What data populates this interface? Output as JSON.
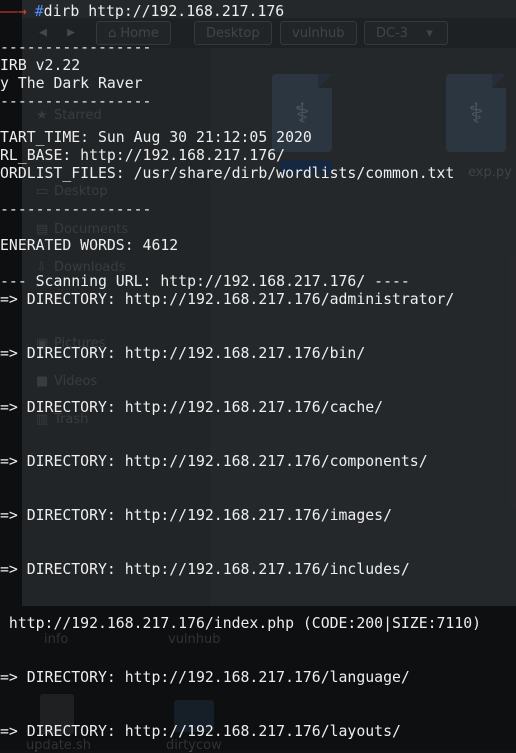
{
  "file_manager": {
    "toolbar": {
      "back_icon": "arrow-left-icon",
      "forward_icon": "arrow-right-icon",
      "home_icon": "home-icon",
      "crumbs": [
        "Home",
        "Desktop",
        "vulnhub",
        "DC-3"
      ],
      "dropdown_icon": "caret-down-icon"
    },
    "sidebar": [
      {
        "label": "Starred",
        "icon": "star-icon"
      },
      {
        "label": "Desktop",
        "icon": "desktop-icon"
      },
      {
        "label": "Documents",
        "icon": "document-icon"
      },
      {
        "label": "Downloads",
        "icon": "download-icon"
      },
      {
        "label": "Pictures",
        "icon": "picture-icon"
      },
      {
        "label": "Videos",
        "icon": "video-icon"
      },
      {
        "label": "Trash",
        "icon": "trash-icon"
      }
    ],
    "files": [
      {
        "label": "",
        "icon": "python-file-icon"
      },
      {
        "label": "exp.py",
        "icon": "python-file-icon"
      }
    ]
  },
  "desktop": {
    "items": [
      {
        "label": "info",
        "icon": "file-icon"
      },
      {
        "label": "vulnhub",
        "icon": "folder-icon"
      },
      {
        "label": "update.sh",
        "icon": "script-file-icon"
      },
      {
        "label": "dirtycow",
        "icon": "folder-icon"
      }
    ]
  },
  "terminal": {
    "prompt_arrow": "——→",
    "prompt_hash": "#",
    "command": "dirb http://192.168.217.176",
    "lines": [
      "-----------------",
      "IRB v2.22",
      "y The Dark Raver",
      "-----------------",
      "",
      "TART_TIME: Sun Aug 30 21:12:05 2020",
      "RL_BASE: http://192.168.217.176/",
      "ORDLIST_FILES: /usr/share/dirb/wordlists/common.txt",
      "",
      "-----------------",
      "",
      "ENERATED WORDS: 4612",
      "",
      "--- Scanning URL: http://192.168.217.176/ ----",
      "=> DIRECTORY: http://192.168.217.176/administrator/",
      "",
      "",
      "=> DIRECTORY: http://192.168.217.176/bin/",
      "",
      "",
      "=> DIRECTORY: http://192.168.217.176/cache/",
      "",
      "",
      "=> DIRECTORY: http://192.168.217.176/components/",
      "",
      "",
      "=> DIRECTORY: http://192.168.217.176/images/",
      "",
      "",
      "=> DIRECTORY: http://192.168.217.176/includes/",
      "",
      "",
      " http://192.168.217.176/index.php (CODE:200|SIZE:7110)",
      "",
      "",
      "=> DIRECTORY: http://192.168.217.176/language/",
      "",
      "",
      "=> DIRECTORY: http://192.168.217.176/layouts/"
    ]
  },
  "colors": {
    "prompt_arrow": "#e33a3a",
    "prompt_hash": "#4f8df0",
    "terminal_text": "#eeeeee",
    "background": "#111213"
  }
}
